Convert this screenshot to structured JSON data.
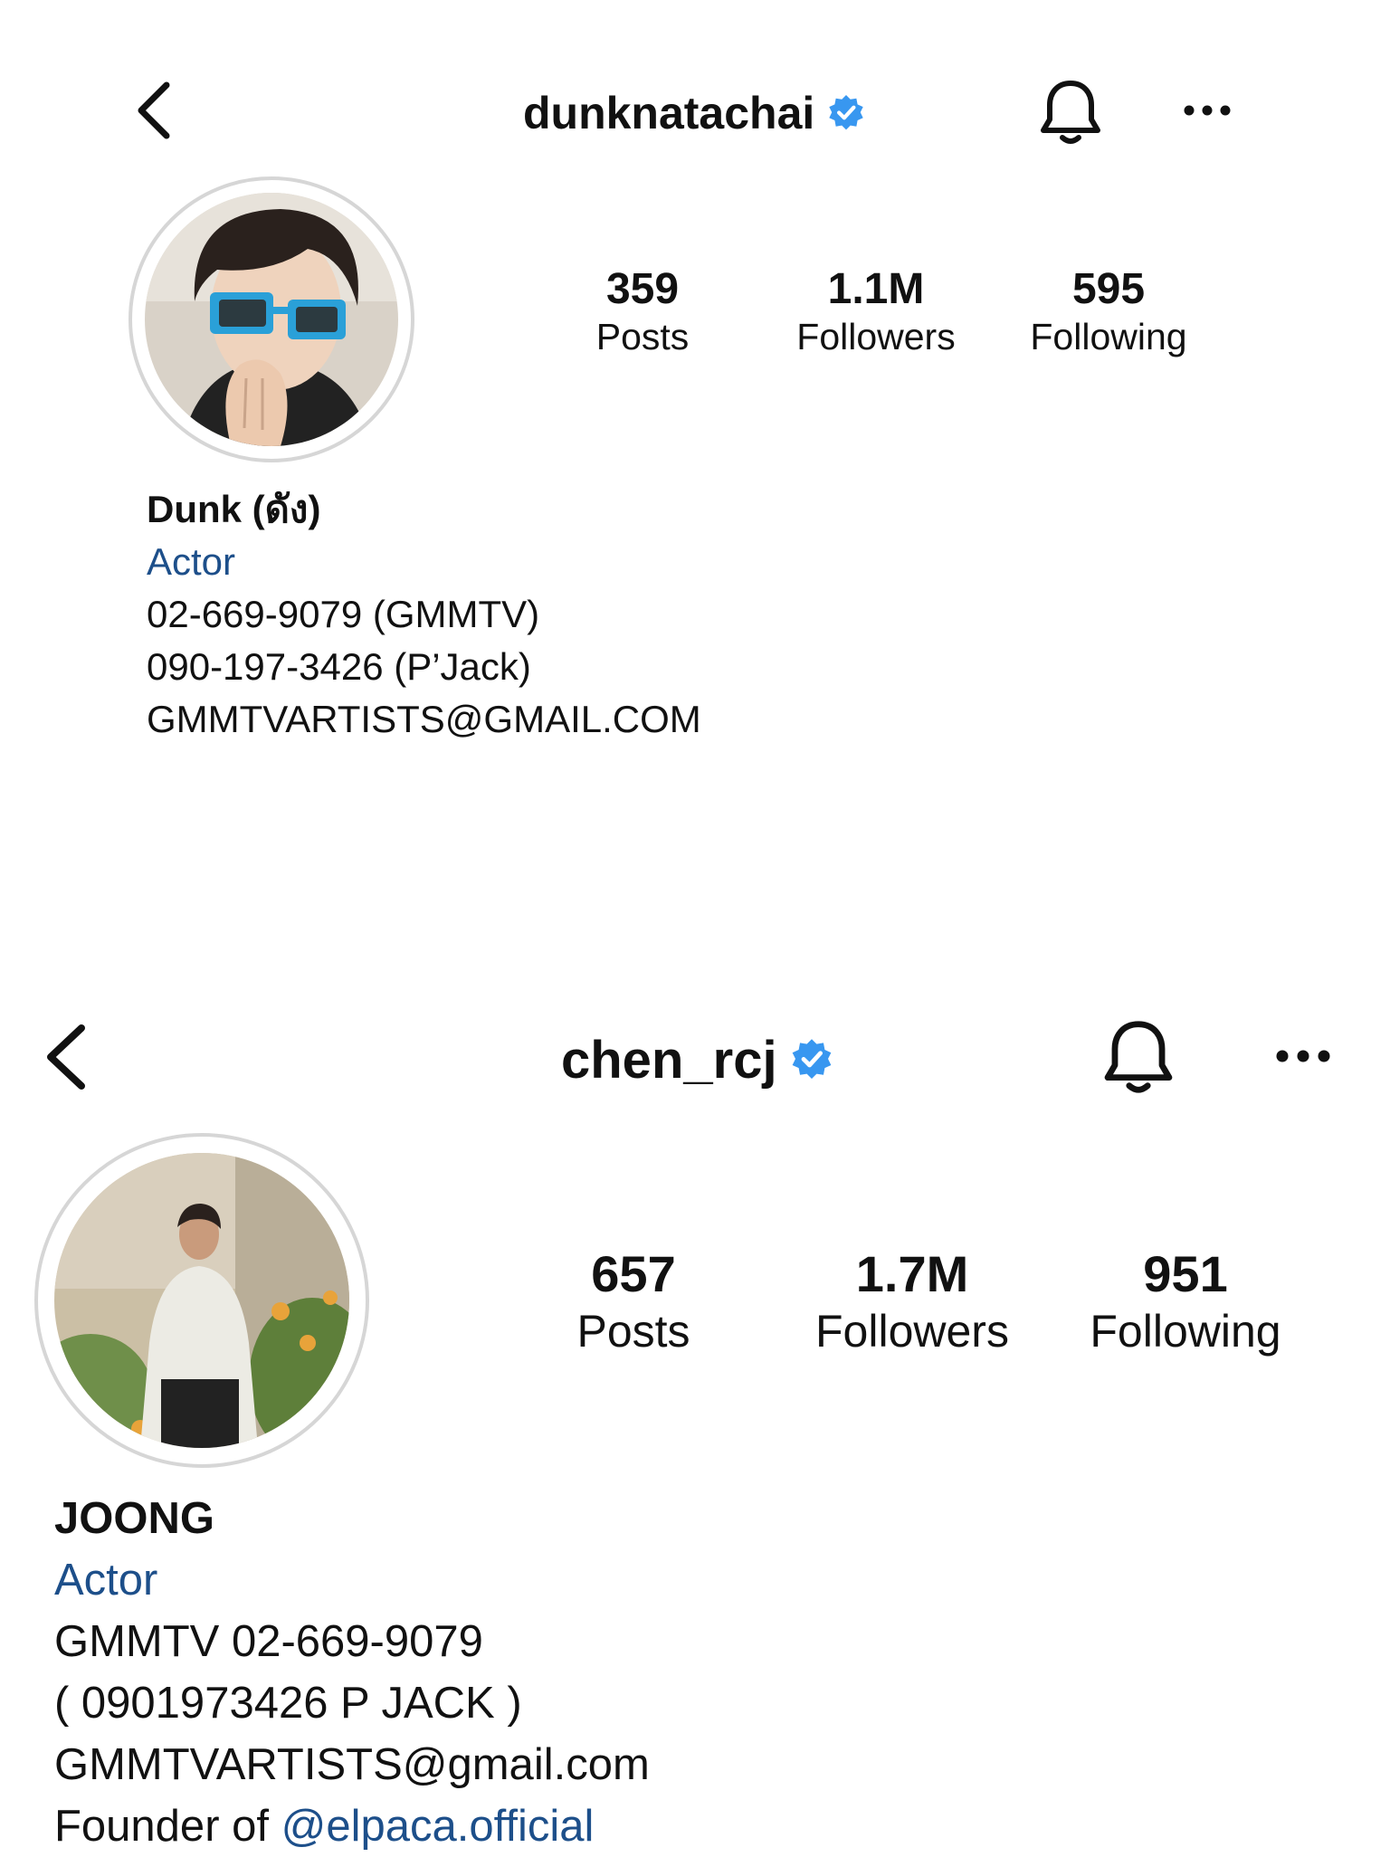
{
  "profiles": [
    {
      "username": "dunknatachai",
      "verified_icon": "verified-badge-icon",
      "stats": [
        {
          "value": "359",
          "label": "Posts"
        },
        {
          "value": "1.1M",
          "label": "Followers"
        },
        {
          "value": "595",
          "label": "Following"
        }
      ],
      "display_name": "Dunk (ดัง)",
      "category": "Actor",
      "bio_lines": [
        "02-669-9079 (GMMTV)",
        "090-197-3426 (P’Jack)",
        "GMMTVARTISTS@GMAIL.COM"
      ]
    },
    {
      "username": "chen_rcj",
      "verified_icon": "verified-badge-icon",
      "stats": [
        {
          "value": "657",
          "label": "Posts"
        },
        {
          "value": "1.7M",
          "label": "Followers"
        },
        {
          "value": "951",
          "label": "Following"
        }
      ],
      "display_name": "JOONG",
      "category": "Actor",
      "bio_lines": [
        "GMMTV 02-669-9079",
        "( 0901973426 P JACK )",
        "GMMTVARTISTS@gmail.com"
      ],
      "bio_founder_prefix": "Founder of ",
      "bio_founder_mention": "@elpaca.official"
    }
  ],
  "colors": {
    "verified": "#3897f0",
    "link": "#1d4f8a",
    "text": "#111111"
  }
}
